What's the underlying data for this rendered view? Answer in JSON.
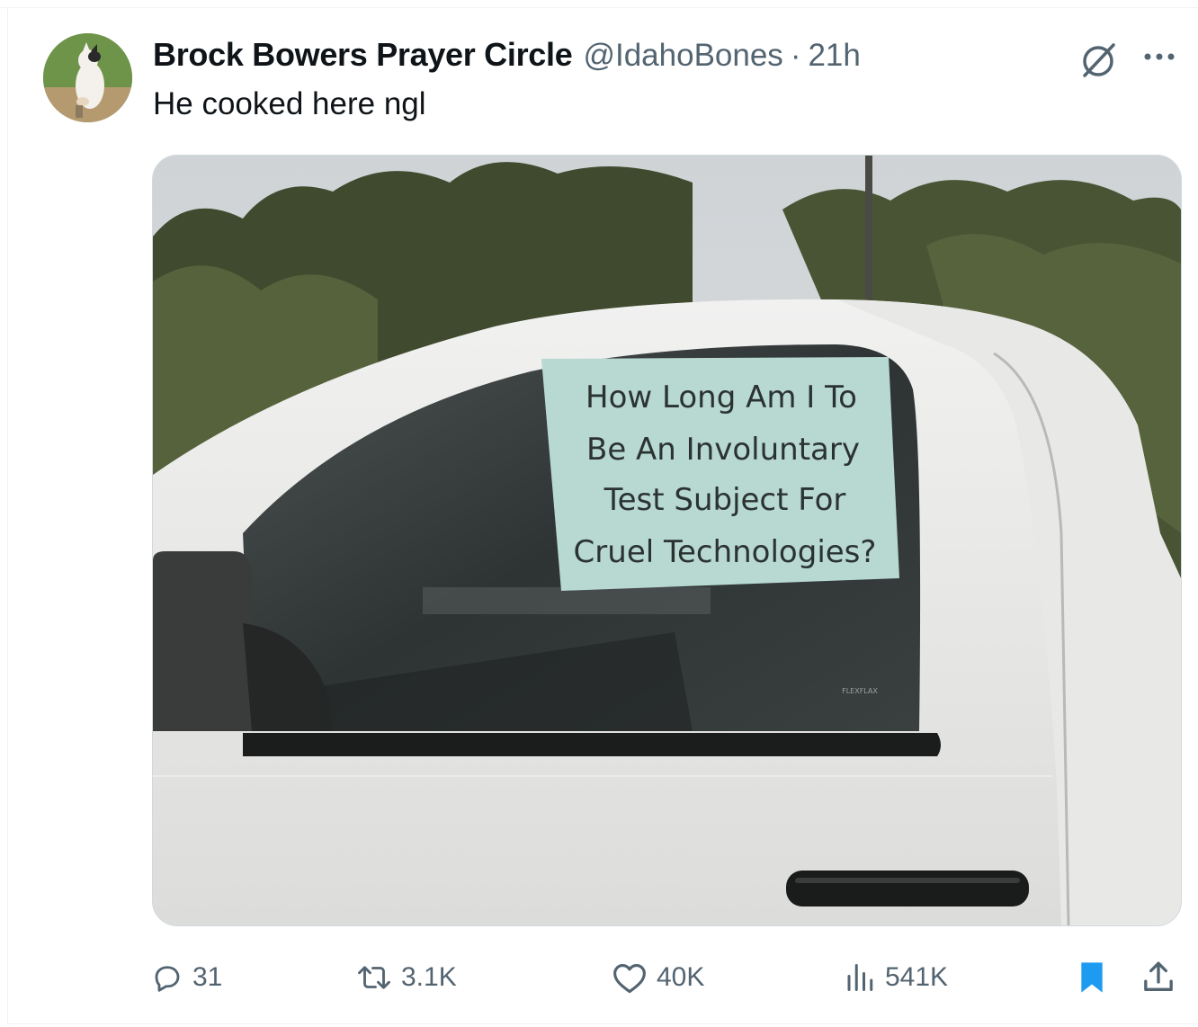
{
  "tweet": {
    "display_name": "Brock Bowers Prayer Circle",
    "handle": "@IdahoBones",
    "separator": "·",
    "time_ago": "21h",
    "text": "He cooked here ngl"
  },
  "media": {
    "sign_lines": [
      "How Long Am I To",
      "Be An Involuntary",
      "Test Subject For",
      "Cruel Technologies?"
    ],
    "sticker_text": "FLEXFLAX"
  },
  "actions": {
    "replies": "31",
    "reposts": "3.1K",
    "likes": "40K",
    "views": "541K"
  },
  "icons": {
    "reply": "speech-bubble-icon",
    "repost": "repost-arrows-icon",
    "like": "heart-icon",
    "views": "bar-chart-icon",
    "bookmark": "bookmark-icon",
    "share": "share-upload-icon",
    "grok": "grok-slash-circle-icon",
    "more": "more-dots-icon"
  },
  "colors": {
    "text_primary": "#0f1419",
    "text_secondary": "#536471",
    "bookmark_active": "#1d9bf0"
  }
}
